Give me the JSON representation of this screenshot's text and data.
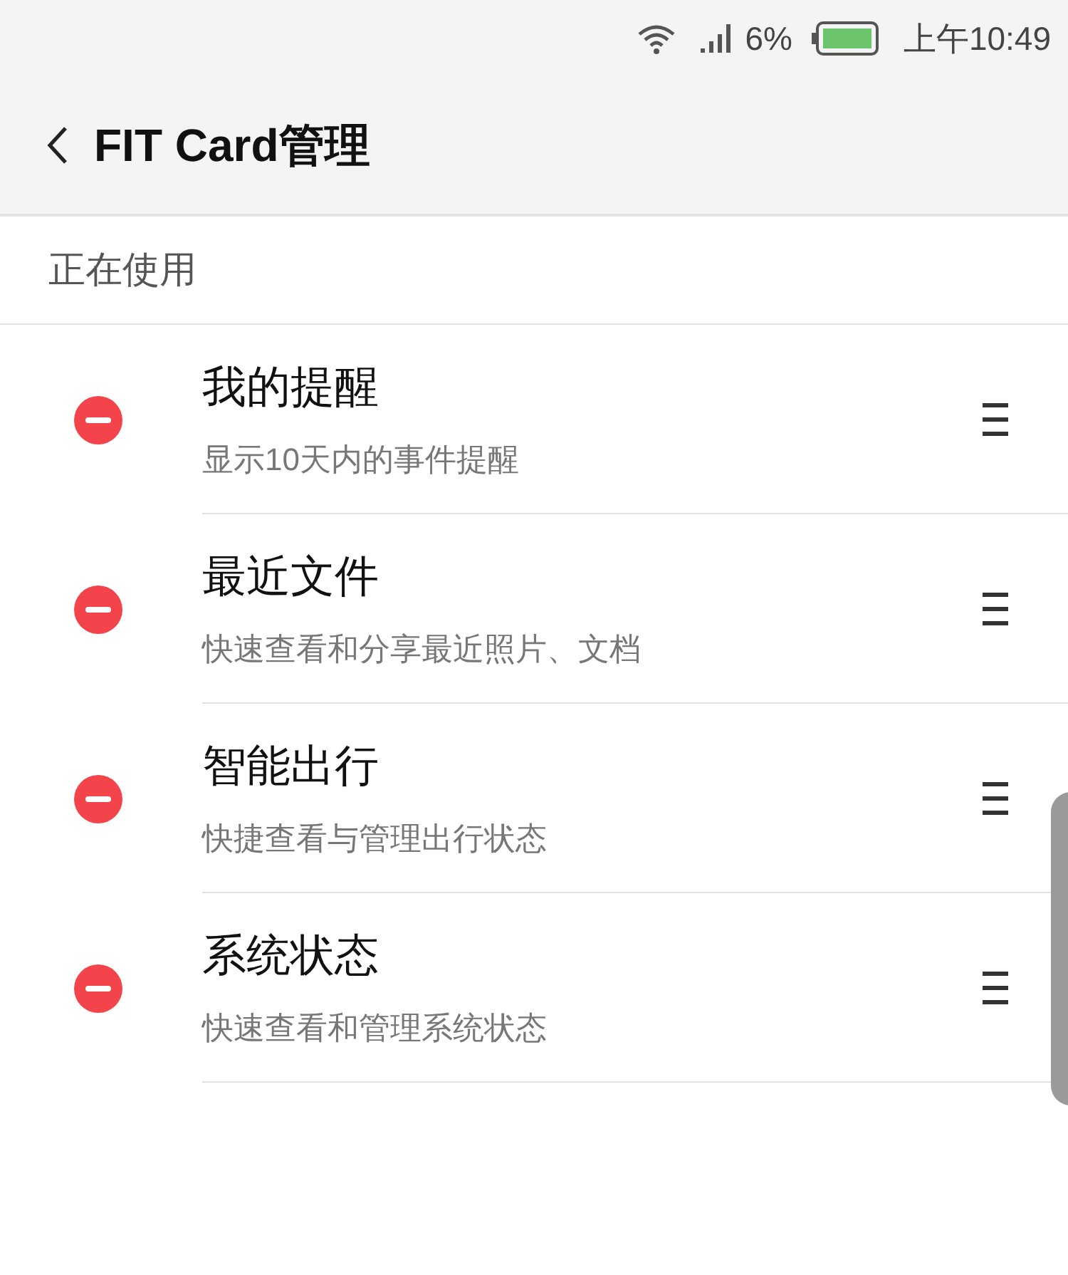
{
  "status_bar": {
    "battery_percent": "6%",
    "time": "上午10:49"
  },
  "header": {
    "title": "FIT Card管理"
  },
  "section": {
    "label": "正在使用"
  },
  "cards": [
    {
      "title": "我的提醒",
      "subtitle": "显示10天内的事件提醒"
    },
    {
      "title": "最近文件",
      "subtitle": "快速查看和分享最近照片、文档"
    },
    {
      "title": "智能出行",
      "subtitle": "快捷查看与管理出行状态"
    },
    {
      "title": "系统状态",
      "subtitle": "快速查看和管理系统状态"
    }
  ]
}
